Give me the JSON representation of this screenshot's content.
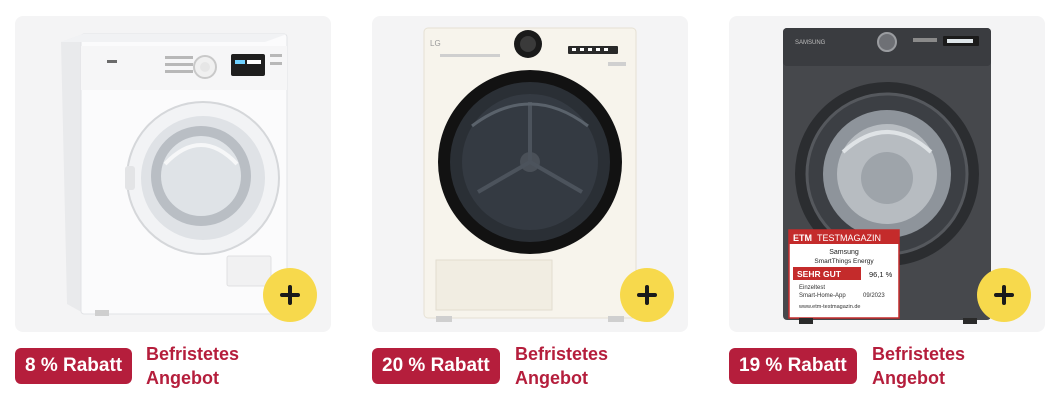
{
  "products": [
    {
      "image_alt": "washing-machine-white",
      "discount": "8 % Rabatt",
      "offer_label": "Befristetes\nAngebot",
      "offer_line1": "Befristetes",
      "offer_line2": "Angebot"
    },
    {
      "image_alt": "dryer-lg-cream",
      "brand": "LG",
      "discount": "20 % Rabatt",
      "offer_line1": "Befristetes",
      "offer_line2": "Angebot"
    },
    {
      "image_alt": "washing-machine-samsung-black",
      "brand": "SAMSUNG",
      "discount": "19 % Rabatt",
      "offer_line1": "Befristetes",
      "offer_line2": "Angebot",
      "test_label": {
        "header_a": "ETM",
        "header_b": "TESTMAGAZIN",
        "line1": "Samsung",
        "line2": "SmartThings Energy",
        "rating": "SEHR GUT",
        "score": "96,1 %",
        "detail1": "Einzeltest",
        "detail2": "Smart-Home-App",
        "date": "09/2023",
        "url": "www.etm-testmagazin.de"
      }
    }
  ],
  "colors": {
    "accent": "#b51e3c",
    "add_button": "#f7d94c",
    "card_bg": "#f4f4f5"
  },
  "icons": {
    "add": "plus-icon"
  }
}
